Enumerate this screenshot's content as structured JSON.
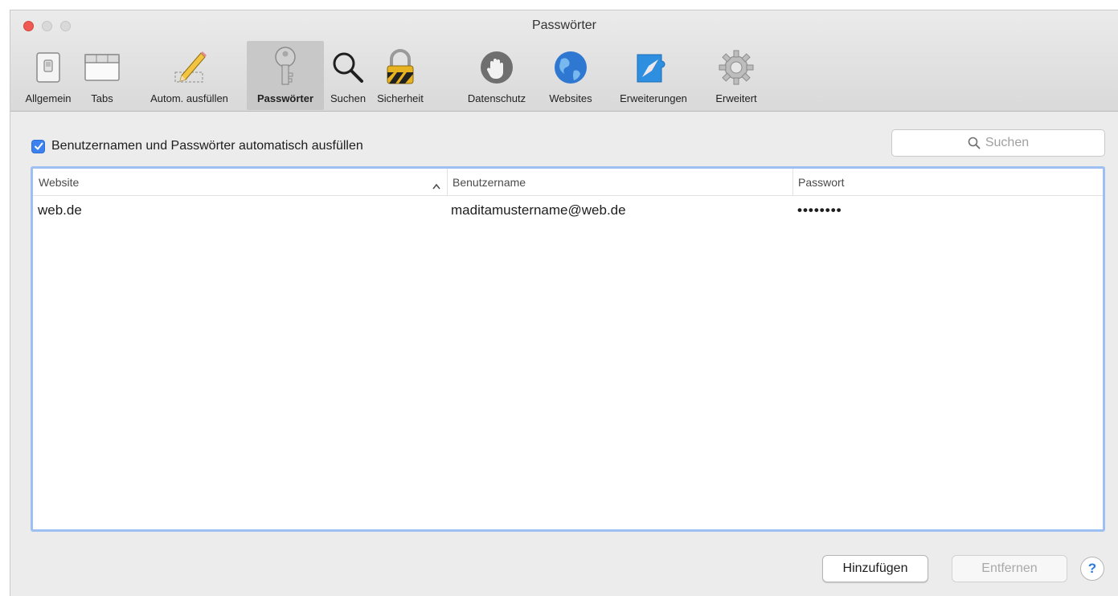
{
  "window": {
    "title": "Passwörter"
  },
  "toolbar": {
    "items": [
      {
        "label": "Allgemein",
        "icon": "switch-icon"
      },
      {
        "label": "Tabs",
        "icon": "tabs-icon"
      },
      {
        "label": "Autom. ausfüllen",
        "icon": "pencil-icon"
      },
      {
        "label": "Passwörter",
        "icon": "key-icon",
        "active": true
      },
      {
        "label": "Suchen",
        "icon": "magnifier-icon"
      },
      {
        "label": "Sicherheit",
        "icon": "lock-icon"
      },
      {
        "label": "Datenschutz",
        "icon": "hand-icon"
      },
      {
        "label": "Websites",
        "icon": "globe-icon"
      },
      {
        "label": "Erweiterungen",
        "icon": "puzzle-compass-icon"
      },
      {
        "label": "Erweitert",
        "icon": "gear-icon"
      }
    ]
  },
  "autofill": {
    "checked": true,
    "label": "Benutzernamen und Passwörter automatisch ausfüllen"
  },
  "search": {
    "placeholder": "Suchen"
  },
  "table": {
    "columns": [
      "Website",
      "Benutzername",
      "Passwort"
    ],
    "sort": {
      "column": "Website",
      "direction": "ascending"
    },
    "rows": [
      {
        "website": "web.de",
        "username": "maditamustername@web.de",
        "password": "••••••••"
      }
    ]
  },
  "buttons": {
    "add": "Hinzufügen",
    "remove": "Entfernen",
    "help": "?"
  },
  "colors": {
    "accent": "#3b82f0",
    "selection_border": "#9dbff2",
    "close_button": "#ee5a52"
  }
}
